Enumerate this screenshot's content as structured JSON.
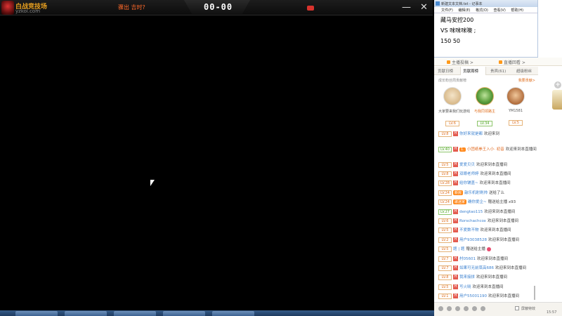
{
  "topbar": {
    "brand": "白战竞技场",
    "brand_sub": "yzkol.com",
    "marquee": "骤出 吉时?",
    "score": "00-00",
    "min_label": "—",
    "close_label": "✕"
  },
  "notepad": {
    "title": "新建文本文档.txt - 记事本",
    "menu": [
      "文件(F)",
      "编辑(E)",
      "格式(O)",
      "查看(V)",
      "帮助(H)"
    ],
    "lines": [
      "藏马安控200",
      "VS 咪咪咪噢 ;",
      "150 50"
    ]
  },
  "promo": {
    "left": "主播投稿 >",
    "right": "直播回看 >"
  },
  "tabs": [
    "贡献日榜",
    "贡献周榜",
    "贵宾(61)",
    "超级粉丝"
  ],
  "fans_header": {
    "left": "成长粉丝周贡献榜",
    "right": "我要贡献>"
  },
  "fans": [
    {
      "name": "大家要来我们玩游戏",
      "lv": "LV.6"
    },
    {
      "name": "与我同领路主",
      "lv": "LV.34"
    },
    {
      "name": "YM1581",
      "lv": "LV.5"
    }
  ],
  "chat": [
    {
      "lv": "LV.8",
      "user": "你好来就是都",
      "text": "欢迎来到"
    },
    {
      "lv": "LV.40",
      "green": true,
      "tag": "1.",
      "user": "小团纸拳王入小· 初音",
      "text": "欢迎来到本直播间"
    },
    {
      "lv": "LV.5",
      "user": "爱爱贝贝",
      "text": "欢迎来到本直播间"
    },
    {
      "lv": "LV.8",
      "user": "双眼老师婷",
      "text": "欢迎来到本直播间"
    },
    {
      "lv": "LV.28",
      "user": "给你铺盖~",
      "text": "欢迎来到本直播间"
    },
    {
      "lv": "LV.24",
      "tag": "新房",
      "user": "敲乐机射刷帅",
      "text": "送给了么"
    },
    {
      "lv": "LV.24",
      "tag": "歌迷家",
      "user": "确你爱企~",
      "text": "赠送给主播 x93"
    },
    {
      "lv": "LV.27",
      "green": true,
      "user": "dengtao115",
      "text": "欢迎来到本直播间"
    },
    {
      "lv": "LV.6",
      "user": "Rorschachcox",
      "text": "欢迎来到本直播间"
    },
    {
      "lv": "LV.5",
      "user": "不爱数不物",
      "text": "欢迎来到本直播间"
    },
    {
      "lv": "LV.2",
      "user": "用户93038528",
      "text": "欢迎来到本直播间"
    },
    {
      "lv": "LV.5",
      "user": "题 | 题",
      "text": "赠送给主播"
    },
    {
      "lv": "LV.7",
      "user": "村05601",
      "text": "欢迎来到本直播间"
    },
    {
      "lv": "LV.7",
      "user": "如果可无前菜高686",
      "text": "欢迎来到本直播间"
    },
    {
      "lv": "LV.8",
      "user": "我来接拼",
      "text": "欢迎来到本直播间"
    },
    {
      "lv": "LV.5",
      "user": "写火晓",
      "text": "欢迎来到本直播间"
    },
    {
      "lv": "LV.1",
      "user": "用户55001190",
      "text": "欢迎来到本直播间"
    }
  ],
  "bottom": {
    "checkbox_label": "屏蔽特效"
  },
  "clock": "15:57"
}
